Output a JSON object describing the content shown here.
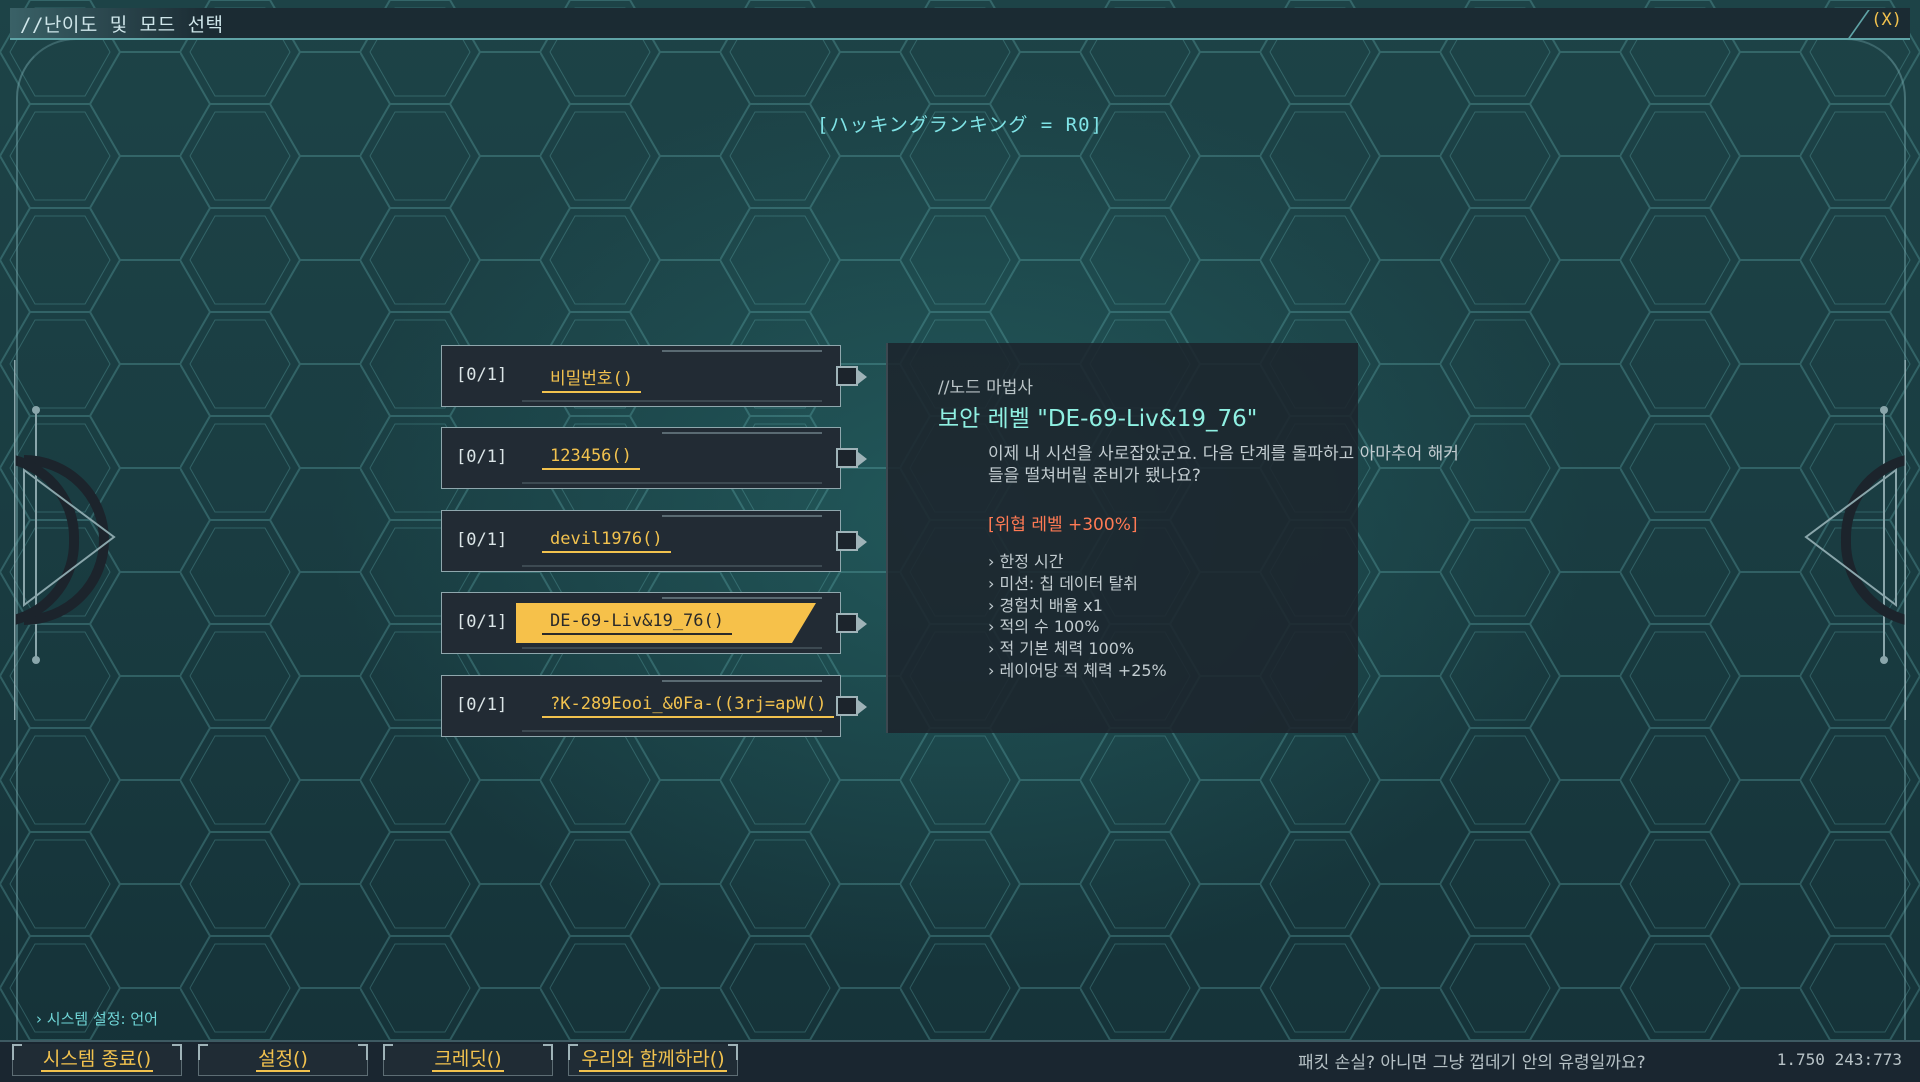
{
  "window": {
    "title": "//난이도 및 모드 선택",
    "close_label": "(X)"
  },
  "header": {
    "ranking": "[ハッキングランキング = R0]"
  },
  "levels": [
    {
      "count": "[0/1]",
      "name": "비밀번호()",
      "selected": false
    },
    {
      "count": "[0/1]",
      "name": "123456()",
      "selected": false
    },
    {
      "count": "[0/1]",
      "name": "devil1976()",
      "selected": false
    },
    {
      "count": "[0/1]",
      "name": "DE-69-Liv&19_76()",
      "selected": true
    },
    {
      "count": "[0/1]",
      "name": "?K-289Eooi_&0Fa-((3rj=apW()",
      "selected": false
    }
  ],
  "panel": {
    "subtitle": "//노드 마법사",
    "title": "보안 레벨 \"DE-69-Liv&19_76\"",
    "desc_line1": "이제 내 시선을 사로잡았군요. 다음 단계를 돌파하고 아마추어 해커",
    "desc_line2": "들을 떨쳐버릴 준비가 됐나요?",
    "threat": "[위협 레벨 +300%]",
    "items": [
      "한정 시간",
      "미션: 칩 데이터 탈취",
      "경험치 배율 x1",
      "적의 수 100%",
      "적 기본 체력 100%",
      "레이어당 적 체력 +25%"
    ]
  },
  "footer": {
    "system_language": "› 시스템 설정: 언어",
    "buttons": [
      "시스템 종료()",
      "설정()",
      "크레딧()",
      "우리와 함께하라()"
    ],
    "tagline": "패킷 손실? 아니면 그냥 껍데기 안의 유령일까요?",
    "coords": "1.750 243:773"
  },
  "colors": {
    "accent_yellow": "#f6c14a",
    "cyan_text": "#7fe3e6",
    "threat_red": "#ff7a54",
    "panel_bg": "#1c242c"
  }
}
